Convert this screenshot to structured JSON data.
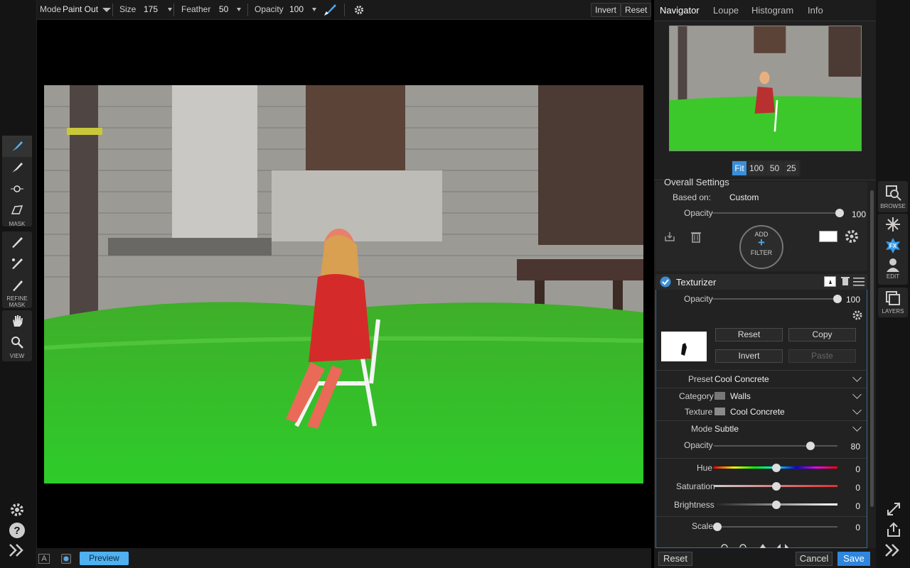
{
  "toolbar": {
    "mode_label": "Mode",
    "mode_value": "Paint Out",
    "size_label": "Size",
    "size_value": "175",
    "feather_label": "Feather",
    "feather_value": "50",
    "opacity_label": "Opacity",
    "opacity_value": "100",
    "invert_label": "Invert",
    "reset_label": "Reset"
  },
  "left_tools": {
    "mask_label": "MASK",
    "refine_label": "REFINE\nMASK",
    "view_label": "VIEW"
  },
  "bottom": {
    "preview_label": "Preview",
    "a_label": "A"
  },
  "navigator": {
    "tabs": [
      "Navigator",
      "Loupe",
      "Histogram",
      "Info"
    ],
    "zoom": [
      "Fit",
      "100",
      "50",
      "25"
    ]
  },
  "overall": {
    "title": "Overall Settings",
    "based_on_label": "Based on:",
    "based_on_value": "Custom",
    "opacity_label": "Opacity",
    "opacity_value": "100",
    "add_label": "ADD",
    "filter_label": "FILTER"
  },
  "texturizer": {
    "title": "Texturizer",
    "opacity_label": "Opacity",
    "opacity_value": "100",
    "reset": "Reset",
    "copy": "Copy",
    "invert": "Invert",
    "paste": "Paste",
    "preset_label": "Preset",
    "preset_value": "Cool Concrete",
    "category_label": "Category",
    "category_value": "Walls",
    "texture_label": "Texture",
    "texture_value": "Cool Concrete",
    "mode_label": "Mode",
    "mode_value": "Subtle",
    "opacity2_label": "Opacity",
    "opacity2_value": "80",
    "hue_label": "Hue",
    "hue_value": "0",
    "saturation_label": "Saturation",
    "saturation_value": "0",
    "brightness_label": "Brightness",
    "brightness_value": "0",
    "scale_label": "Scale",
    "scale_value": "0"
  },
  "footer": {
    "reset": "Reset",
    "cancel": "Cancel",
    "save": "Save"
  },
  "farbar": {
    "browse": "BROWSE",
    "edit": "EDIT",
    "layers": "LAYERS",
    "fx": "FX"
  },
  "colors": {
    "accent": "#3a8fd8",
    "save": "#2f86de",
    "preview": "#4fb1f0"
  }
}
